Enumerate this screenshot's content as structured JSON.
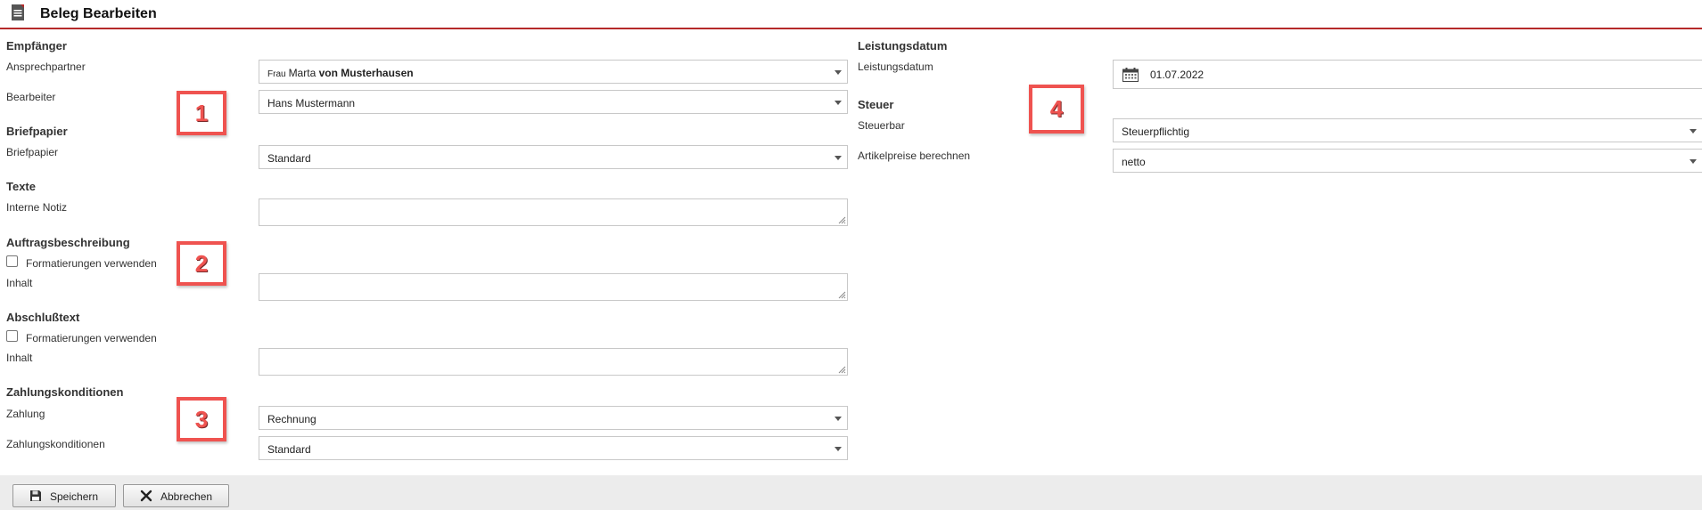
{
  "header": {
    "title": "Beleg Bearbeiten",
    "icon": "document-edit-icon"
  },
  "left": {
    "empfaenger": {
      "heading": "Empfänger",
      "ansprechpartner": {
        "label": "Ansprechpartner",
        "salutation": "Frau",
        "firstname": "Marta",
        "lastname": "von Musterhausen"
      },
      "bearbeiter": {
        "label": "Bearbeiter",
        "value": "Hans Mustermann"
      }
    },
    "briefpapier": {
      "heading": "Briefpapier",
      "label": "Briefpapier",
      "value": "Standard"
    },
    "texte": {
      "heading": "Texte",
      "notiz_label": "Interne Notiz",
      "notiz_value": ""
    },
    "auftrag": {
      "heading": "Auftragsbeschreibung",
      "checkbox_label": "Formatierungen verwenden",
      "checked": false,
      "inhalt_label": "Inhalt",
      "inhalt_value": ""
    },
    "abschluss": {
      "heading": "Abschlußtext",
      "checkbox_label": "Formatierungen verwenden",
      "checked": false,
      "inhalt_label": "Inhalt",
      "inhalt_value": ""
    },
    "zahlung": {
      "heading": "Zahlungskonditionen",
      "zahlung_label": "Zahlung",
      "zahlung_value": "Rechnung",
      "konditionen_label": "Zahlungskonditionen",
      "konditionen_value": "Standard"
    }
  },
  "right": {
    "leistung": {
      "heading": "Leistungsdatum",
      "label": "Leistungsdatum",
      "value": "01.07.2022"
    },
    "steuer": {
      "heading": "Steuer",
      "steuerbar_label": "Steuerbar",
      "steuerbar_value": "Steuerpflichtig",
      "artikelpreise_label": "Artikelpreise berechnen",
      "artikelpreise_value": "netto"
    }
  },
  "markers": [
    "1",
    "2",
    "3",
    "4"
  ],
  "footer": {
    "save_label": "Speichern",
    "cancel_label": "Abbrechen"
  },
  "colors": {
    "accent": "#b52a2a",
    "marker": "#ef5350",
    "footer_bg": "#ececec"
  }
}
